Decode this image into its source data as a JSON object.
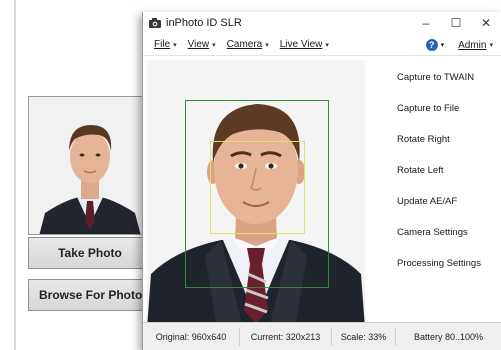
{
  "background_app": {
    "take_photo_label": "Take Photo",
    "browse_label": "Browse For Photo"
  },
  "window": {
    "title": "inPhoto ID SLR",
    "controls": {
      "minimize": "–",
      "maximize": "☐",
      "close": "✕"
    }
  },
  "menu": {
    "items": [
      {
        "label": "File"
      },
      {
        "label": "View"
      },
      {
        "label": "Camera"
      },
      {
        "label": "Live View"
      }
    ],
    "help_icon": "help-icon",
    "admin_label": "Admin"
  },
  "actions": [
    "Capture to TWAIN",
    "Capture to File",
    "Rotate Right",
    "Rotate Left",
    "Update AE/AF",
    "Camera Settings",
    "Processing Settings"
  ],
  "status": {
    "original": "Original: 960x640",
    "current": "Current: 320x213",
    "scale": "Scale: 33%",
    "battery": "Battery 80..100%"
  },
  "colors": {
    "face_frame": "#2e8b3a",
    "eye_frame": "#e7df6c",
    "help": "#2b63b4"
  }
}
